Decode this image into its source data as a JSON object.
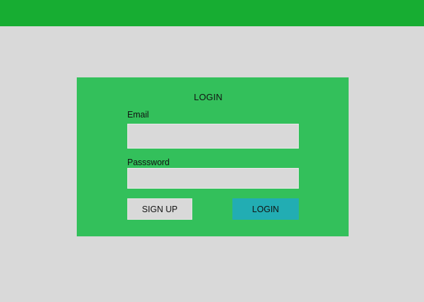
{
  "header": {
    "color": "#17ad32"
  },
  "login_panel": {
    "title": "LOGIN",
    "email_label": "Email",
    "email_value": "",
    "password_label": "Passsword",
    "password_value": "",
    "signup_button_label": "SIGN UP",
    "login_button_label": "LOGIN"
  },
  "colors": {
    "page_background": "#d9d9d9",
    "panel_background": "#33c05b",
    "login_button": "#22adb3",
    "signup_button": "#d9d9d9"
  }
}
